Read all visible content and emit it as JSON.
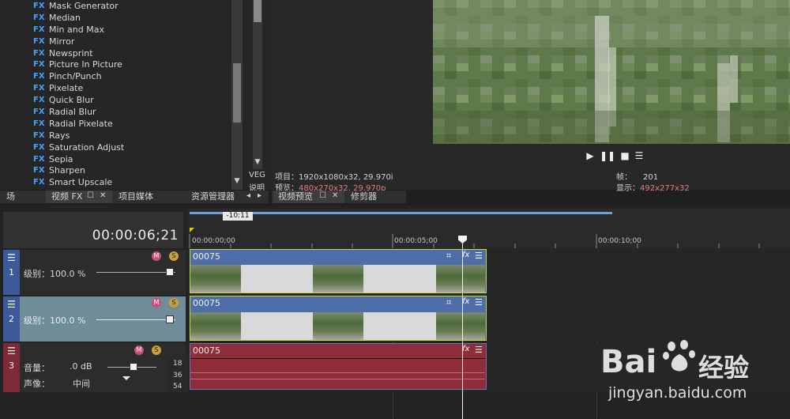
{
  "fx_list": [
    "Mask Generator",
    "Median",
    "Min and Max",
    "Mirror",
    "Newsprint",
    "Picture In Picture",
    "Pinch/Punch",
    "Pixelate",
    "Quick Blur",
    "Radial Blur",
    "Radial Pixelate",
    "Rays",
    "Saturation Adjust",
    "Sepia",
    "Sharpen",
    "Smart Upscale"
  ],
  "fx_badge": "FX",
  "mid_panel": {
    "line1": "VEG",
    "line2": "说明"
  },
  "left_tabs": {
    "cut": "场",
    "video_fx": "视频 FX",
    "project_media": "项目媒体",
    "explorer": "资源管理器"
  },
  "preview_tabs": {
    "video_preview": "视频预览",
    "trimmer": "修剪器"
  },
  "preview_info": {
    "project_label": "项目：1920x1080x32, 29.970i",
    "preview_label": "预览：",
    "preview_value": "480x270x32, 29.970p",
    "frame_label": "帧：",
    "frame_value": "201",
    "display_label": "显示：",
    "display_value": "492x277x32"
  },
  "timeline": {
    "time_display": "00:00:06;21",
    "loop_label": "-10:11",
    "ruler": [
      "00:00:00;00",
      "00:00:05;00",
      "00:00:10;00"
    ]
  },
  "tracks": [
    {
      "number": "1",
      "level_label": "级别：100.0 %",
      "clip_name": "00075"
    },
    {
      "number": "2",
      "level_label": "级别：100.0 %",
      "clip_name": "00075"
    },
    {
      "number": "3",
      "volume_label": "音量：",
      "volume_value": ".0 dB",
      "pan_label": "声像：",
      "pan_value": "中间",
      "clip_name": "00075",
      "db_marks": [
        "18",
        "36",
        "54"
      ]
    }
  ],
  "watermark": {
    "brand": "Bai",
    "brand2": "经验",
    "url": "jingyan.baidu.com"
  },
  "colors": {
    "fx_blue": "#3fa5ff",
    "video_clip": "#4d6ea8",
    "audio_clip": "#8f2d3b",
    "clip_border": "#c9d936",
    "track2_selected": "#6f8d99",
    "cursor": "#ffffff"
  }
}
